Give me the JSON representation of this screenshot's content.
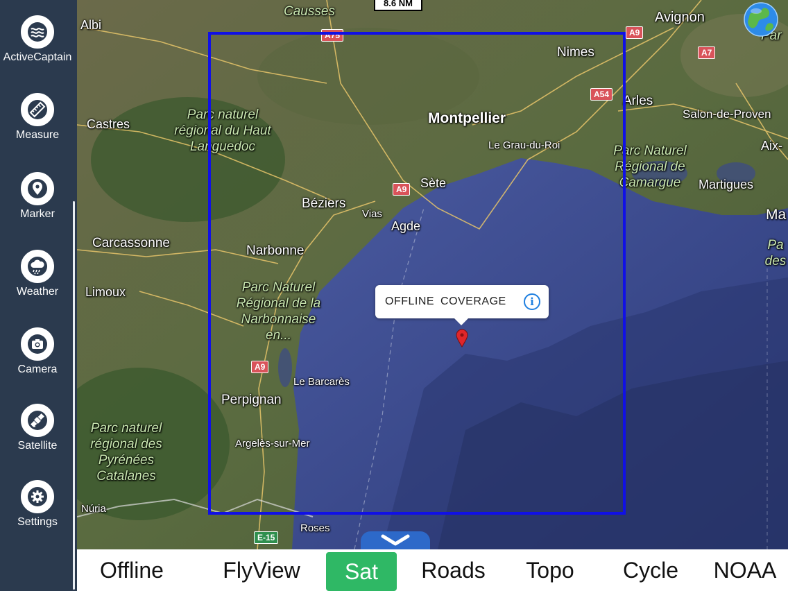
{
  "sidebar": {
    "items": [
      {
        "label": "ActiveCaptain",
        "icon": "waves-icon"
      },
      {
        "label": "Measure",
        "icon": "ruler-icon"
      },
      {
        "label": "Marker",
        "icon": "location-pin-icon"
      },
      {
        "label": "Weather",
        "icon": "cloud-rain-icon"
      },
      {
        "label": "Camera",
        "icon": "camera-icon"
      },
      {
        "label": "Satellite",
        "icon": "satellite-icon"
      },
      {
        "label": "Settings",
        "icon": "gear-icon"
      }
    ]
  },
  "map": {
    "scale": "8.6 NM",
    "callout": {
      "text": "OFFLINE COVERAGE",
      "info_glyph": "i"
    },
    "places": {
      "albi": "Albi",
      "causses": "Causses",
      "avignon": "Avignon",
      "nimes": "Nimes",
      "arles": "Arles",
      "salon": "Salon-de-Proven",
      "aix": "Aix-",
      "castres": "Castres",
      "montpellier": "Montpellier",
      "legrau": "Le Grau-du-Roi",
      "sete": "Sète",
      "beziers": "Béziers",
      "vias": "Vias",
      "agde": "Agde",
      "martigues": "Martigues",
      "ma": "Ma",
      "carcassonne": "Carcassonne",
      "narbonne": "Narbonne",
      "limoux": "Limoux",
      "lebarcares": "Le Barcarès",
      "perpignan": "Perpignan",
      "argeles": "Argelès-sur-Mer",
      "nuria": "Núria",
      "roses": "Roses",
      "par": "Par"
    },
    "parks": {
      "haut_languedoc": "Parc naturel régional du Haut Languedoc",
      "camargue": "Parc Naturel Régional de Camargue",
      "narbonnaise": "Parc Naturel Régional de la Narbonnaise en...",
      "pyrenees": "Parc naturel régional des Pyrénées Catalanes",
      "des": "Pa des"
    },
    "roads": {
      "a75": "A75",
      "a9_top": "A9",
      "a7": "A7",
      "a54": "A54",
      "a9_sete": "A9",
      "a9_south": "A9",
      "e15": "E-15"
    }
  },
  "bottombar": {
    "tabs": [
      {
        "label": "Offline",
        "active": false
      },
      {
        "label": "FlyView",
        "active": false
      },
      {
        "label": "Sat",
        "active": true
      },
      {
        "label": "Roads",
        "active": false
      },
      {
        "label": "Topo",
        "active": false
      },
      {
        "label": "Cycle",
        "active": false
      },
      {
        "label": "NOAA",
        "active": false
      }
    ]
  },
  "colors": {
    "sidebar": "#2b3a4e",
    "coverage_border": "#1010e6",
    "active_tab": "#2fb865",
    "sea": "#3d4f93"
  }
}
